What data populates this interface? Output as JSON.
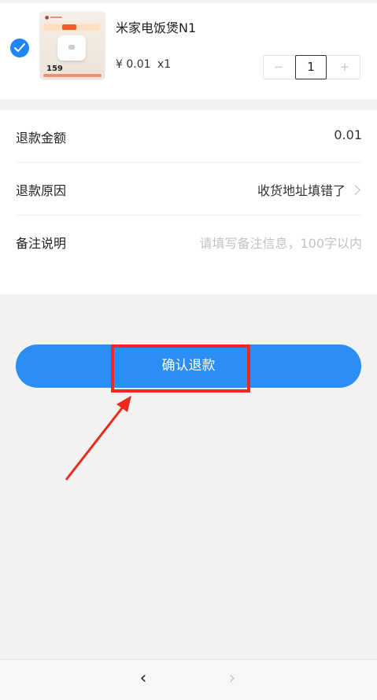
{
  "product": {
    "name": "米家电饭煲N1",
    "unit_price": "¥ 0.01",
    "quantity_text": "x1",
    "quantity": "1",
    "minus_symbol": "−",
    "plus_symbol": "+",
    "selected": true,
    "thumb_price": "159"
  },
  "refund_form": {
    "amount_label": "退款金额",
    "amount_value": "0.01",
    "reason_label": "退款原因",
    "reason_value": "收货地址填错了",
    "remark_label": "备注说明",
    "remark_placeholder": "请填写备注信息，100字以内"
  },
  "confirm_button": {
    "label": "确认退款"
  },
  "bottom_nav": {
    "back_symbol": "‹",
    "forward_symbol": "›"
  },
  "colors": {
    "accent": "#2a8ef4",
    "highlight": "#e92a1c",
    "background": "#f2f2f2"
  },
  "icons": [
    "check-icon",
    "chevron-right-icon",
    "back-arrow-icon",
    "forward-arrow-icon"
  ]
}
